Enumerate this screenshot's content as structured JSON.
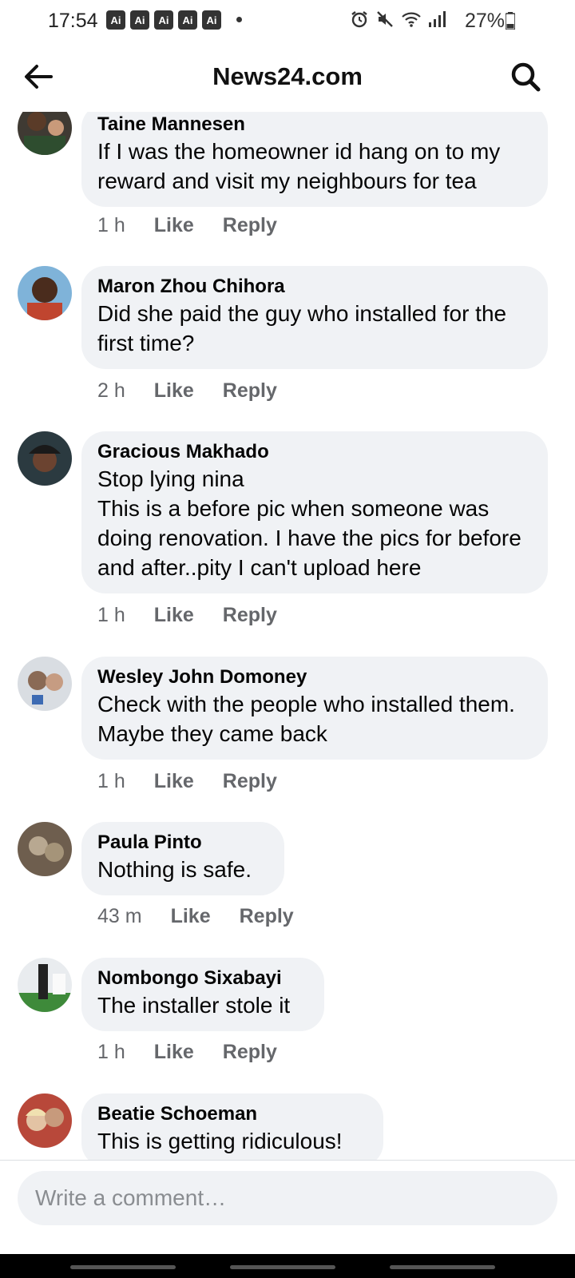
{
  "status": {
    "time": "17:54",
    "ai_badges": [
      "Ai",
      "Ai",
      "Ai",
      "Ai",
      "Ai"
    ],
    "battery": "27%",
    "icons": [
      "alarm-icon",
      "mute-icon",
      "wifi-icon",
      "signal-icon",
      "battery-icon"
    ]
  },
  "header": {
    "title": "News24.com",
    "back_icon": "arrow-left-icon",
    "search_icon": "search-icon"
  },
  "comments": [
    {
      "author": "Taine Mannesen",
      "text": "If I was the homeowner id hang  on to my reward and visit my neighbours for tea",
      "time": "1 h",
      "like": "Like",
      "reply": "Reply"
    },
    {
      "author": "Maron Zhou Chihora",
      "text": "Did she paid the guy who installed for the first time?",
      "time": "2 h",
      "like": "Like",
      "reply": "Reply"
    },
    {
      "author": "Gracious Makhado",
      "text": "Stop lying nina\nThis is a before pic when someone was doing renovation. I have the pics for before and after..pity I can't upload here",
      "time": "1 h",
      "like": "Like",
      "reply": "Reply"
    },
    {
      "author": "Wesley John Domoney",
      "text": "Check with the people who installed them.  Maybe they came back",
      "time": "1 h",
      "like": "Like",
      "reply": "Reply"
    },
    {
      "author": "Paula Pinto",
      "text": "Nothing is safe.",
      "time": "43 m",
      "like": "Like",
      "reply": "Reply"
    },
    {
      "author": "Nombongo Sixabayi",
      "text": "The installer stole it",
      "time": "1 h",
      "like": "Like",
      "reply": "Reply"
    },
    {
      "author": "Beatie Schoeman",
      "text": "This is getting ridiculous!",
      "time": "",
      "like": "",
      "reply": ""
    }
  ],
  "composer": {
    "placeholder": "Write a comment…"
  },
  "colors": {
    "bubble": "#f0f2f5",
    "meta": "#65676b",
    "text": "#050505"
  }
}
